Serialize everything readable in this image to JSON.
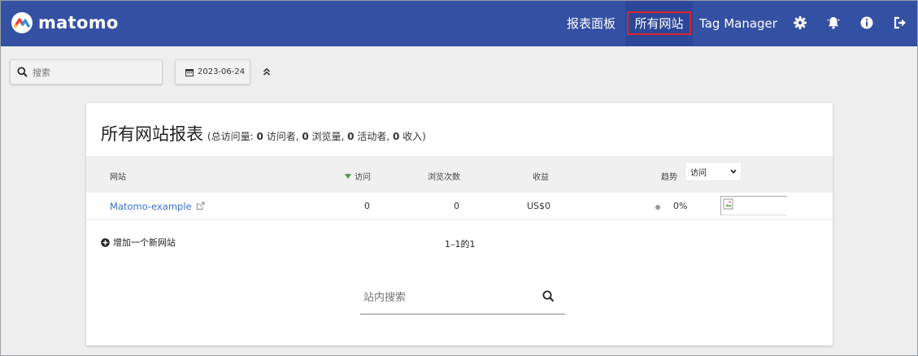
{
  "header": {
    "logo_text": "matomo",
    "nav": {
      "dashboard": "报表面板",
      "all_websites": "所有网站",
      "tag_manager": "Tag Manager"
    },
    "colors": {
      "bar": "#3450a3",
      "active_highlight": "#d9232b"
    },
    "icons": [
      "gear-icon",
      "bell-icon",
      "info-icon",
      "logout-icon"
    ]
  },
  "toolbar": {
    "search_placeholder": "搜索",
    "date": "2023-06-24"
  },
  "report": {
    "title": "所有网站报表",
    "summary": {
      "prefix": "(总访问量: ",
      "visits": "0",
      "visits_label": " 访问者, ",
      "pageviews": "0",
      "pageviews_label": " 浏览量, ",
      "actions": "0",
      "actions_label": " 活动者, ",
      "revenue": "0",
      "revenue_label": " 收入)"
    },
    "columns": {
      "site": "网站",
      "visits": "访问",
      "pageviews": "浏览次数",
      "revenue": "收益",
      "trend": "趋势",
      "trend_select": "访问"
    },
    "rows": [
      {
        "site": "Matomo-example",
        "visits": "0",
        "pageviews": "0",
        "revenue": "US$0",
        "trend": "0%"
      }
    ],
    "add_site": "增加一个新网站",
    "pagination": "1–1的1",
    "site_search_placeholder": "站内搜索"
  }
}
